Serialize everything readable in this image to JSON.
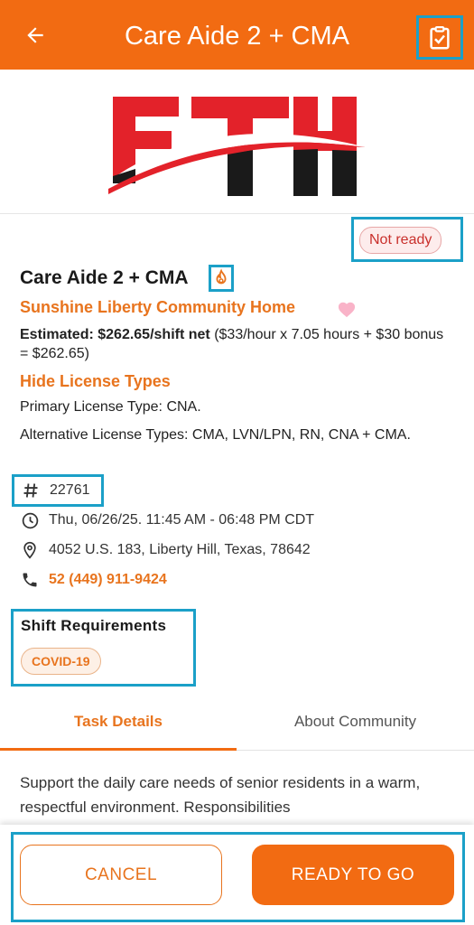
{
  "header": {
    "title": "Care Aide 2 + CMA",
    "back_icon": "arrow-left-icon",
    "action_icon": "clipboard-check-icon",
    "bg_color": "#f26b12"
  },
  "logo": {
    "text": "FTH",
    "colors": [
      "#e3222a",
      "#1a1a1a"
    ]
  },
  "status_badge": "Not ready",
  "shift": {
    "title": "Care Aide 2 + CMA",
    "community": "Sunshine Liberty Community Home",
    "estimate_label": "Estimated: $262.65/shift net",
    "estimate_detail": " ($33/hour x 7.05 hours + $30 bonus = $262.65)",
    "hide_license_link": "Hide License Types",
    "primary_label": "Primary License Type:",
    "primary_value": " CNA.",
    "alt_label": "Alternative License Types:",
    "alt_value": " CMA, LVN/LPN, RN, CNA + CMA.",
    "id": "22761",
    "datetime": "Thu, 06/26/25. 11:45 AM - 06:48 PM CDT",
    "address": "4052 U.S. 183, Liberty Hill, Texas, 78642",
    "phone": "52 (449) 911-9424"
  },
  "requirements": {
    "label": "Shift Requirements",
    "chips": [
      "COVID-19"
    ]
  },
  "tabs": [
    {
      "label": "Task Details",
      "active": true
    },
    {
      "label": "About Community",
      "active": false
    }
  ],
  "description": "Support the daily care needs of senior residents in a warm, respectful environment. Responsibilities",
  "buttons": {
    "cancel": "CANCEL",
    "ready": "READY TO GO"
  },
  "accent_color": "#e8741e",
  "highlight_color": "#1ba0c8"
}
